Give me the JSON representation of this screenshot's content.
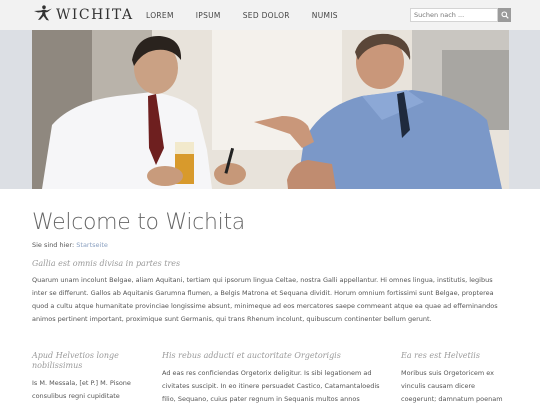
{
  "header": {
    "logo_text": "WICHITA",
    "logo_icon": "dancer-icon",
    "nav": [
      {
        "label": "LOREM"
      },
      {
        "label": "IPSUM"
      },
      {
        "label": "SED DOLOR"
      },
      {
        "label": "NUMIS"
      }
    ],
    "search": {
      "placeholder": "Suchen nach ...",
      "icon": "search-icon"
    }
  },
  "hero": {
    "image": "two-businessmen-talking"
  },
  "main": {
    "title": "Welcome to Wichita",
    "breadcrumb_prefix": "Sie sind hier:",
    "breadcrumb_link": "Startseite",
    "subtitle": "Gallia est omnis divisa in partes tres",
    "intro": "Quarum unam incolunt Belgae, aliam Aquitani, tertiam qui ipsorum lingua Celtae, nostra Galli appellantur. Hi omnes lingua, institutis, legibus inter se differunt. Gallos ab Aquitanis Garumna flumen, a Belgis Matrona et Sequana dividit. Horum omnium fortissimi sunt Belgae, propterea quod a cultu atque humanitate provinciae longissime absunt, minimeque ad eos mercatores saepe commeant atque ea quae ad effeminandos animos pertinent important, proximique sunt Germanis, qui trans Rhenum incolunt, quibuscum continenter bellum gerunt."
  },
  "columns": [
    {
      "heading": "Apud Helvetios longe nobilissimus",
      "text": "Is M. Messala, [et P.] M. Pisone consulibus regni cupiditate"
    },
    {
      "heading": "His rebus adducti et auctoritate Orgetorigis",
      "text": "Ad eas res conficiendas Orgetorix deligitur. Is sibi legationem ad civitates suscipit. In eo itinere persuadet Castico, Catamantaloedis filio, Sequano, cuius pater regnum in Sequanis multos annos obtinuerat et a"
    },
    {
      "heading": "Ea res est Helvetiis",
      "text": "Moribus suis Orgetoricem ex vinculis causam dicere coegerunt; damnatum poenam sequi"
    }
  ],
  "colors": {
    "header_bg": "#f2f2f2",
    "link": "#8aa0c0",
    "heading_italic": "#9a9a9a"
  }
}
